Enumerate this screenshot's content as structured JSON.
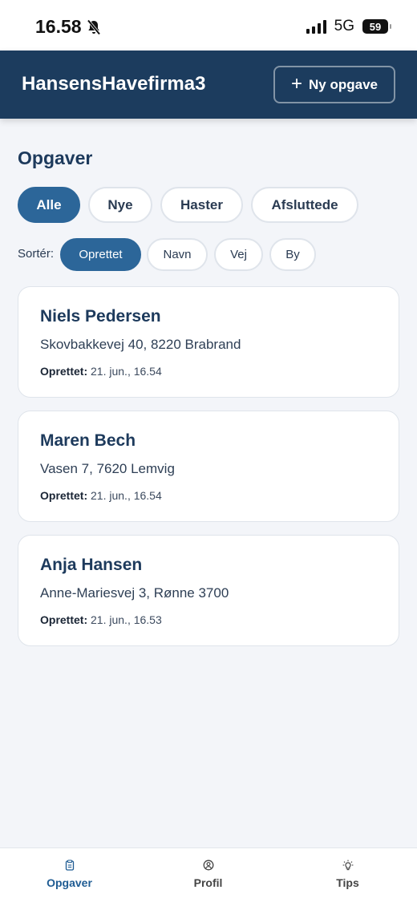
{
  "status": {
    "time": "16.58",
    "network": "5G",
    "battery": "59"
  },
  "header": {
    "title": "HansensHavefirma3",
    "new_task_label": "Ny opgave"
  },
  "page": {
    "title": "Opgaver"
  },
  "filters": [
    {
      "label": "Alle",
      "active": true
    },
    {
      "label": "Nye",
      "active": false
    },
    {
      "label": "Haster",
      "active": false
    },
    {
      "label": "Afsluttede",
      "active": false
    }
  ],
  "sort": {
    "label": "Sortér:",
    "options": [
      {
        "label": "Oprettet",
        "active": true
      },
      {
        "label": "Navn",
        "active": false
      },
      {
        "label": "Vej",
        "active": false
      },
      {
        "label": "By",
        "active": false
      }
    ]
  },
  "tasks": [
    {
      "name": "Niels Pedersen",
      "address": "Skovbakkevej 40, 8220 Brabrand",
      "created_label": "Oprettet:",
      "created": "21. jun., 16.54"
    },
    {
      "name": "Maren Bech",
      "address": "Vasen 7, 7620 Lemvig",
      "created_label": "Oprettet:",
      "created": "21. jun., 16.54"
    },
    {
      "name": "Anja Hansen",
      "address": "Anne-Mariesvej 3, Rønne 3700",
      "created_label": "Oprettet:",
      "created": "21. jun., 16.53"
    }
  ],
  "nav": [
    {
      "label": "Opgaver",
      "icon": "clipboard-icon",
      "active": true
    },
    {
      "label": "Profil",
      "icon": "user-circle-icon",
      "active": false
    },
    {
      "label": "Tips",
      "icon": "lightbulb-icon",
      "active": false
    }
  ],
  "colors": {
    "header_bg": "#1c3c5e",
    "accent": "#2c6699",
    "nav_active": "#1f5c93"
  }
}
